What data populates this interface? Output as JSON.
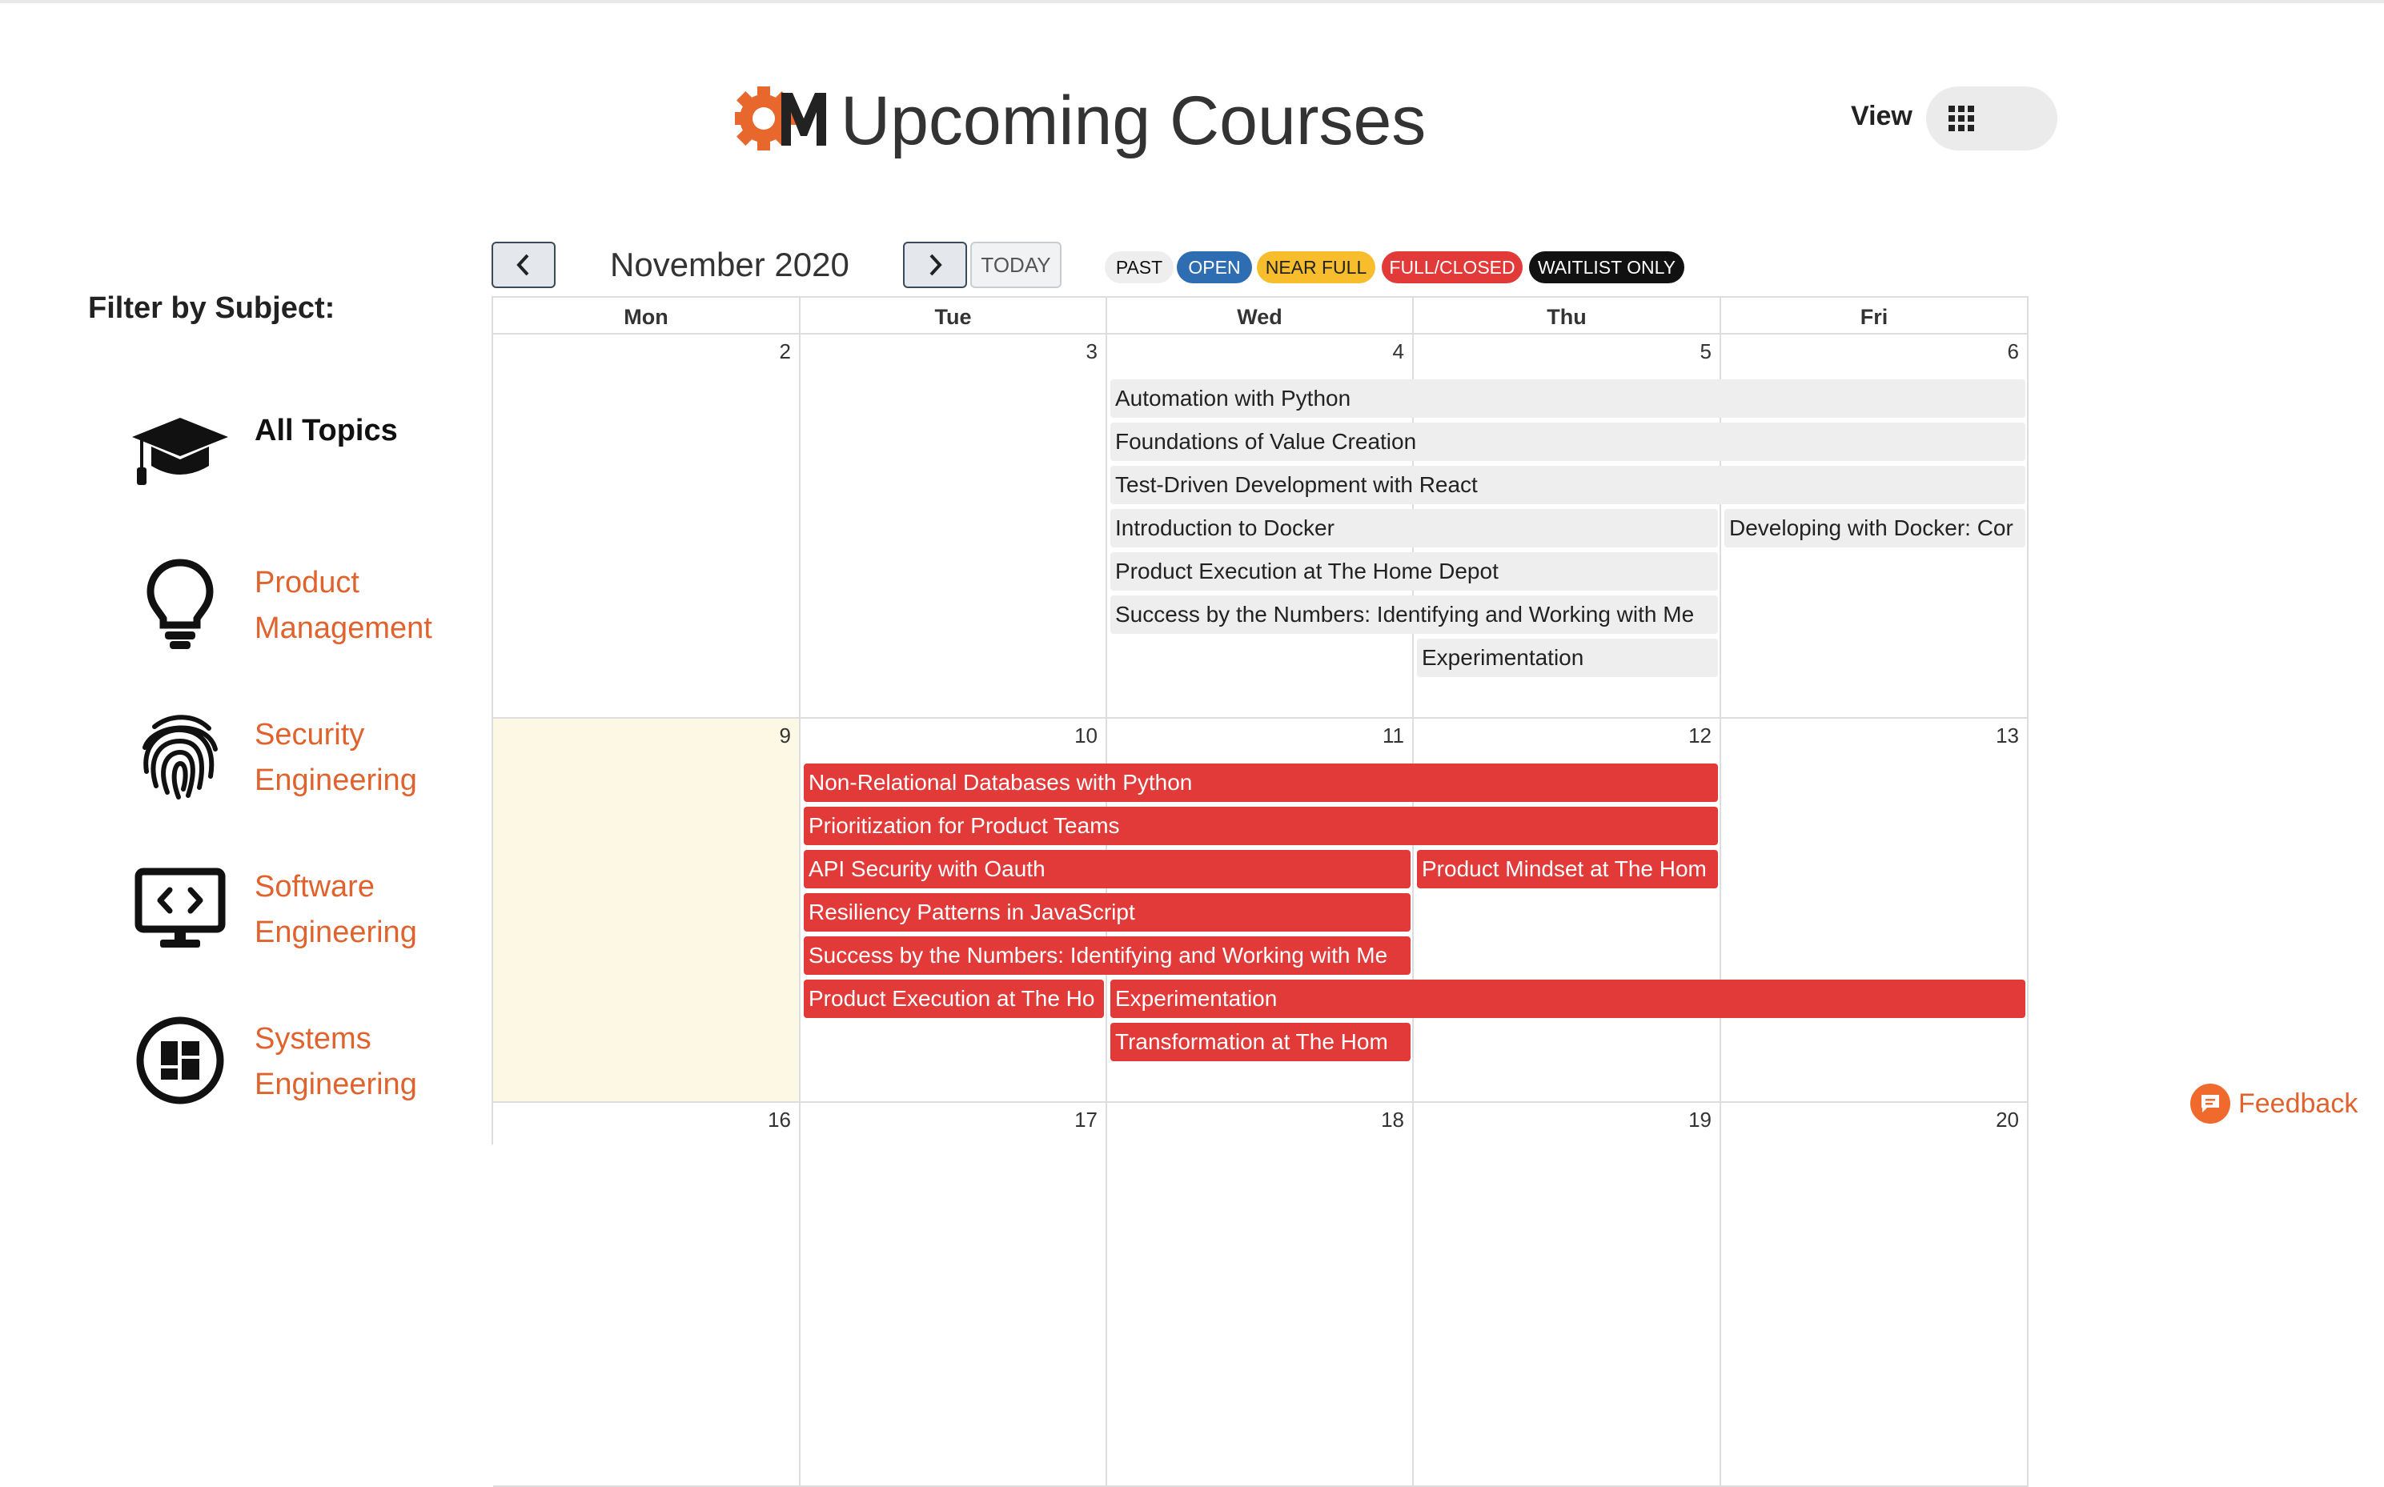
{
  "header": {
    "title": "Upcoming Courses",
    "view_label": "View"
  },
  "sidebar": {
    "title": "Filter by Subject:",
    "subjects": [
      {
        "label": "All Topics",
        "icon": "graduation-cap-icon",
        "active": true
      },
      {
        "label": "Product Management",
        "icon": "lightbulb-icon"
      },
      {
        "label": "Security Engineering",
        "icon": "fingerprint-icon"
      },
      {
        "label": "Software Engineering",
        "icon": "monitor-code-icon"
      },
      {
        "label": "Systems Engineering",
        "icon": "dashboard-circle-icon"
      }
    ]
  },
  "toolbar": {
    "month": "November 2020",
    "today_label": "TODAY"
  },
  "legend": [
    {
      "label": "PAST",
      "bg": "#eeeeee",
      "color": "#111111"
    },
    {
      "label": "OPEN",
      "bg": "#2f6db3",
      "color": "#ffffff"
    },
    {
      "label": "NEAR FULL",
      "bg": "#f7bd2c",
      "color": "#222222"
    },
    {
      "label": "FULL/CLOSED",
      "bg": "#e23939",
      "color": "#ffffff"
    },
    {
      "label": "WAITLIST ONLY",
      "bg": "#111111",
      "color": "#ffffff"
    }
  ],
  "calendar": {
    "days": [
      "Mon",
      "Tue",
      "Wed",
      "Thu",
      "Fri"
    ],
    "weeks": [
      {
        "dates": [
          "2",
          "3",
          "4",
          "5",
          "6"
        ]
      },
      {
        "dates": [
          "9",
          "10",
          "11",
          "12",
          "13"
        ]
      },
      {
        "dates": [
          "16",
          "17",
          "18",
          "19",
          "20"
        ]
      }
    ],
    "events": [
      {
        "title": "Automation with Python",
        "week": 0,
        "start": 2,
        "span": 3,
        "row": 0,
        "status": "past"
      },
      {
        "title": "Foundations of Value Creation",
        "week": 0,
        "start": 2,
        "span": 3,
        "row": 1,
        "status": "past"
      },
      {
        "title": "Test-Driven Development with React",
        "week": 0,
        "start": 2,
        "span": 3,
        "row": 2,
        "status": "past"
      },
      {
        "title": "Introduction to Docker",
        "week": 0,
        "start": 2,
        "span": 2,
        "row": 3,
        "status": "past"
      },
      {
        "title": "Developing with Docker: Cor",
        "week": 0,
        "start": 4,
        "span": 1,
        "row": 3,
        "status": "past"
      },
      {
        "title": "Product Execution at The Home Depot",
        "week": 0,
        "start": 2,
        "span": 2,
        "row": 4,
        "status": "past"
      },
      {
        "title": "Success by the Numbers: Identifying and Working with Me",
        "week": 0,
        "start": 2,
        "span": 2,
        "row": 5,
        "status": "past"
      },
      {
        "title": "Experimentation",
        "week": 0,
        "start": 3,
        "span": 1,
        "row": 6,
        "status": "past"
      },
      {
        "title": "Non-Relational Databases with Python",
        "week": 1,
        "start": 1,
        "span": 3,
        "row": 0,
        "status": "full"
      },
      {
        "title": "Prioritization for Product Teams",
        "week": 1,
        "start": 1,
        "span": 3,
        "row": 1,
        "status": "full"
      },
      {
        "title": "API Security with Oauth",
        "week": 1,
        "start": 1,
        "span": 2,
        "row": 2,
        "status": "full"
      },
      {
        "title": "Product Mindset at The Hom",
        "week": 1,
        "start": 3,
        "span": 1,
        "row": 2,
        "status": "full"
      },
      {
        "title": "Resiliency Patterns in JavaScript",
        "week": 1,
        "start": 1,
        "span": 2,
        "row": 3,
        "status": "full"
      },
      {
        "title": "Success by the Numbers: Identifying and Working with Me",
        "week": 1,
        "start": 1,
        "span": 2,
        "row": 4,
        "status": "full"
      },
      {
        "title": "Product Execution at The Ho",
        "week": 1,
        "start": 1,
        "span": 1,
        "row": 5,
        "status": "full"
      },
      {
        "title": "Experimentation",
        "week": 1,
        "start": 2,
        "span": 3,
        "row": 5,
        "status": "full"
      },
      {
        "title": "Transformation at The Hom",
        "week": 1,
        "start": 2,
        "span": 1,
        "row": 6,
        "status": "full"
      }
    ]
  },
  "feedback": {
    "label": "Feedback"
  },
  "colors": {
    "accent": "#f16a2d",
    "full": "#e23939",
    "past": "#eeeeee",
    "today": "#fdf8e4"
  }
}
